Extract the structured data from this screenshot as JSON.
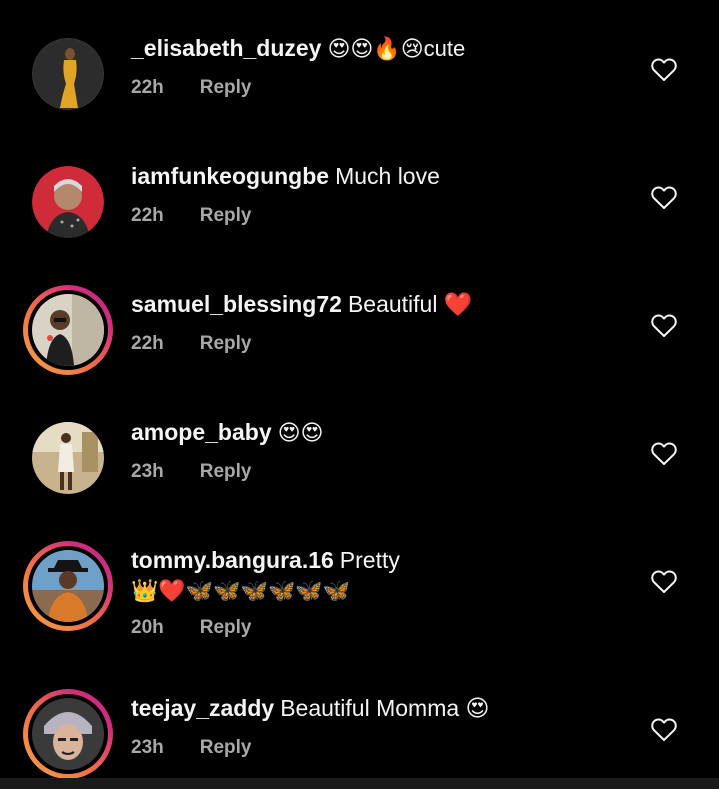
{
  "comments": [
    {
      "username": "_elisabeth_duzey",
      "text": "😍😍🔥😢cute",
      "time": "22h",
      "reply_label": "Reply",
      "has_story_ring": false,
      "avatar_icon": "avatar-photo"
    },
    {
      "username": "iamfunkeogungbe",
      "text": "Much love",
      "time": "22h",
      "reply_label": "Reply",
      "has_story_ring": false,
      "avatar_icon": "avatar-photo"
    },
    {
      "username": "samuel_blessing72",
      "text": "Beautiful ❤️",
      "time": "22h",
      "reply_label": "Reply",
      "has_story_ring": true,
      "avatar_icon": "avatar-photo"
    },
    {
      "username": "amope_baby",
      "text": "😍😍",
      "time": "23h",
      "reply_label": "Reply",
      "has_story_ring": false,
      "avatar_icon": "avatar-photo"
    },
    {
      "username": "tommy.bangura.16",
      "text": "Pretty",
      "text_line2": "👑❤️🦋🦋🦋🦋🦋🦋",
      "time": "20h",
      "reply_label": "Reply",
      "has_story_ring": true,
      "avatar_icon": "avatar-photo"
    },
    {
      "username": "teejay_zaddy",
      "text": "Beautiful Momma 😍",
      "time": "23h",
      "reply_label": "Reply",
      "has_story_ring": true,
      "avatar_icon": "avatar-photo"
    }
  ],
  "icons": {
    "like": "heart-outline-icon"
  },
  "colors": {
    "background": "#000000",
    "username": "#f5f5f5",
    "meta": "#a8a8a8",
    "story_ring_start": "#f9a545",
    "story_ring_end": "#b82585"
  }
}
